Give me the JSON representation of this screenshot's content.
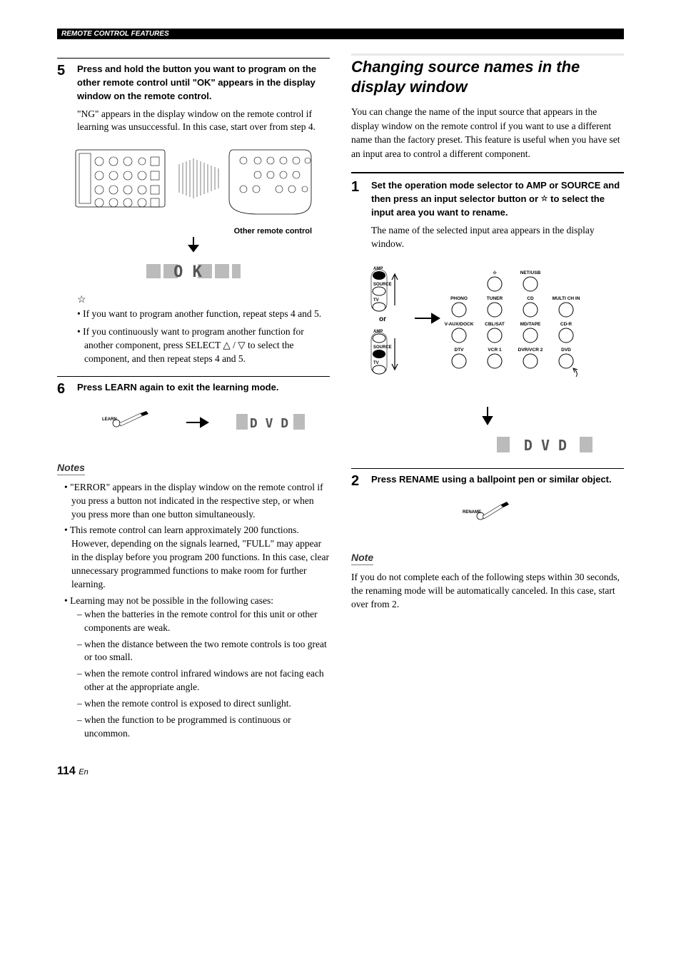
{
  "header": {
    "section": "REMOTE CONTROL FEATURES"
  },
  "left": {
    "step5": {
      "num": "5",
      "title": "Press and hold the button you want to program on the other remote control until \"OK\" appears in the display window on the remote control.",
      "body": "\"NG\" appears in the display window on the remote control if learning was unsuccessful. In this case, start over from step 4.",
      "caption_other": "Other remote control",
      "lcd_ok": "O K"
    },
    "tips": [
      "If you want to program another function, repeat steps 4 and 5.",
      "If you continuously want to program another function for another component, press SELECT △ / ▽ to select the component, and then repeat steps 4 and 5."
    ],
    "step6": {
      "num": "6",
      "title": "Press LEARN again to exit the learning mode.",
      "learn_label": "LEARN",
      "lcd_dvd": "D V D"
    },
    "notes_title": "Notes",
    "notes": [
      "\"ERROR\" appears in the display window on the remote control if you press a button not indicated in the respective step, or when you press more than one button simultaneously.",
      "This remote control can learn approximately 200 functions. However, depending on the signals learned, \"FULL\" may appear in the display before you program 200 functions. In this case, clear unnecessary programmed functions to make room for further learning.",
      "Learning may not be possible in the following cases:"
    ],
    "subnotes": [
      "when the batteries in the remote control for this unit or other components are weak.",
      "when the distance between the two remote controls is too great or too small.",
      "when the remote control infrared windows are not facing each other at the appropriate angle.",
      "when the remote control is exposed to direct sunlight.",
      "when the function to be programmed is continuous or uncommon."
    ]
  },
  "right": {
    "title": "Changing source names in the display window",
    "intro": "You can change the name of the input source that appears in the display window on the remote control if you want to use a different name than the factory preset. This feature is useful when you have set an input area to control a different component.",
    "step1": {
      "num": "1",
      "title_a": "Set the operation mode selector to AMP or SOURCE and then press an input selector button or ",
      "title_b": " to select the input area you want to rename.",
      "body": "The name of the selected input area appears in the display window.",
      "or": "or",
      "sw": {
        "amp": "AMP",
        "source": "SOURCE",
        "tv": "TV"
      },
      "btns": {
        "star": "☆",
        "netusb": "NET/USB",
        "phono": "PHONO",
        "tuner": "TUNER",
        "cd": "CD",
        "multi": "MULTI CH IN",
        "vaux": "V-AUX/DOCK",
        "cbl": "CBL/SAT",
        "md": "MD/TAPE",
        "cdr": "CD-R",
        "dtv": "DTV",
        "vcr1": "VCR 1",
        "dvr": "DVR/VCR 2",
        "dvd": "DVD"
      },
      "lcd": "D V D"
    },
    "step2": {
      "num": "2",
      "title": "Press RENAME using a ballpoint pen or similar object.",
      "rename_label": "RENAME"
    },
    "note_title": "Note",
    "note_body": "If you do not complete each of the following steps within 30 seconds, the renaming mode will be automatically canceled. In this case, start over from 2."
  },
  "page": {
    "num": "114",
    "suffix": "En"
  }
}
